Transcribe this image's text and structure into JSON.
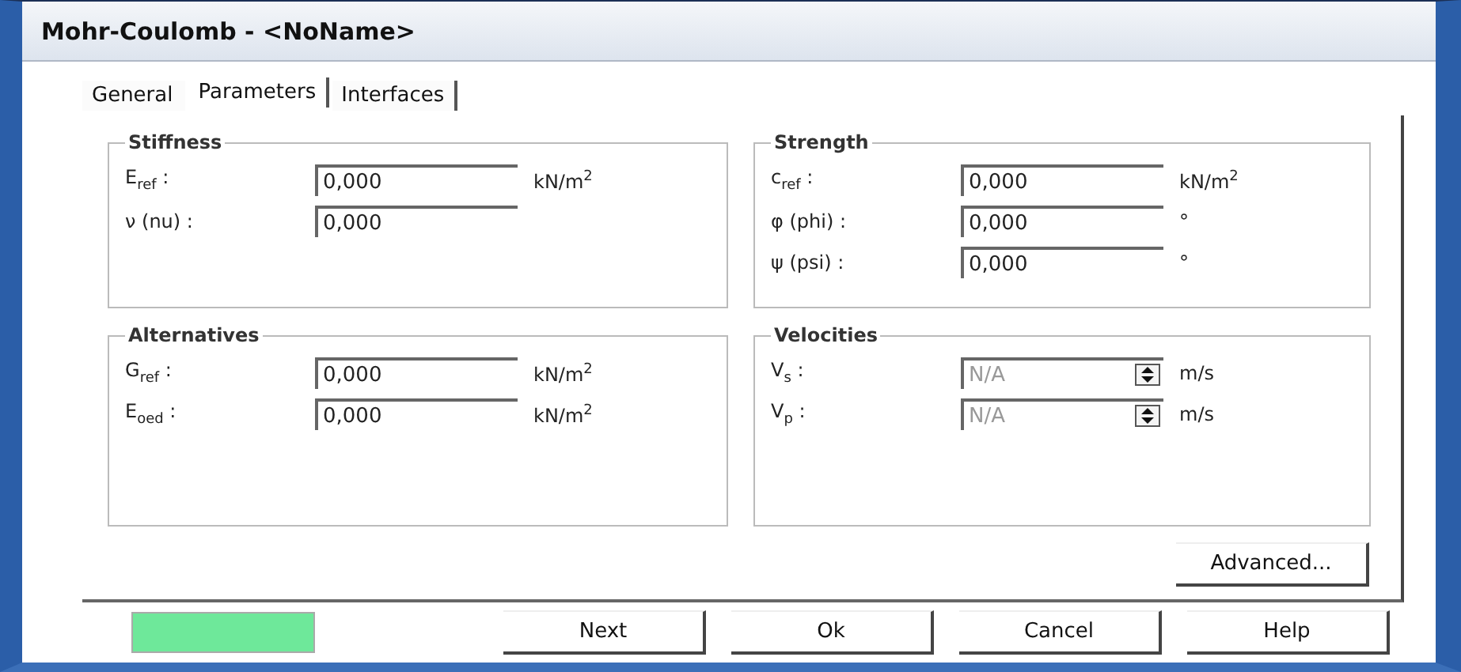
{
  "window": {
    "title": "Mohr-Coulomb - <NoName>"
  },
  "tabs": [
    {
      "label": "General",
      "selected": false
    },
    {
      "label": "Parameters",
      "selected": true
    },
    {
      "label": "Interfaces",
      "selected": false
    }
  ],
  "groups": [
    {
      "title": "Stiffness",
      "rows": [
        {
          "label": "E$_{ref}$ :",
          "kind": "text",
          "value": "0,000",
          "unit": "kN/m$^{2}$",
          "disabled": false
        },
        {
          "label": "ν (nu) :",
          "kind": "text",
          "value": "0,000",
          "disabled": false
        }
      ]
    },
    {
      "title": "Strength",
      "rows": [
        {
          "label": "c$_{ref}$ :",
          "kind": "text",
          "value": "0,000",
          "unit": "kN/m$^{2}$",
          "disabled": false
        },
        {
          "label": "φ (phi) :",
          "kind": "text",
          "value": "0,000",
          "unit": "°",
          "disabled": false
        },
        {
          "label": "ψ (psi) :",
          "kind": "text",
          "value": "0,000",
          "unit": "°",
          "disabled": false
        }
      ]
    },
    {
      "title": "Alternatives",
      "rows": [
        {
          "label": "G$_{ref}$ :",
          "kind": "text",
          "value": "0,000",
          "unit": "kN/m$^{2}$",
          "disabled": false
        },
        {
          "label": "E$_{oed}$ :",
          "kind": "text",
          "value": "0,000",
          "unit": "kN/m$^{2}$",
          "disabled": false
        }
      ]
    },
    {
      "title": "Velocities",
      "rows": [
        {
          "label": "V$_{s}$ :",
          "kind": "spin",
          "value": "N/A",
          "unit": "m/s",
          "disabled": true
        },
        {
          "label": "V$_{p}$ :",
          "kind": "spin",
          "value": "N/A",
          "unit": "m/s",
          "disabled": true
        }
      ]
    }
  ],
  "advanced_button": "Advanced...",
  "status": {
    "color": "#6ee89a"
  },
  "buttons": [
    "Next",
    "Ok",
    "Cancel",
    "Help"
  ]
}
